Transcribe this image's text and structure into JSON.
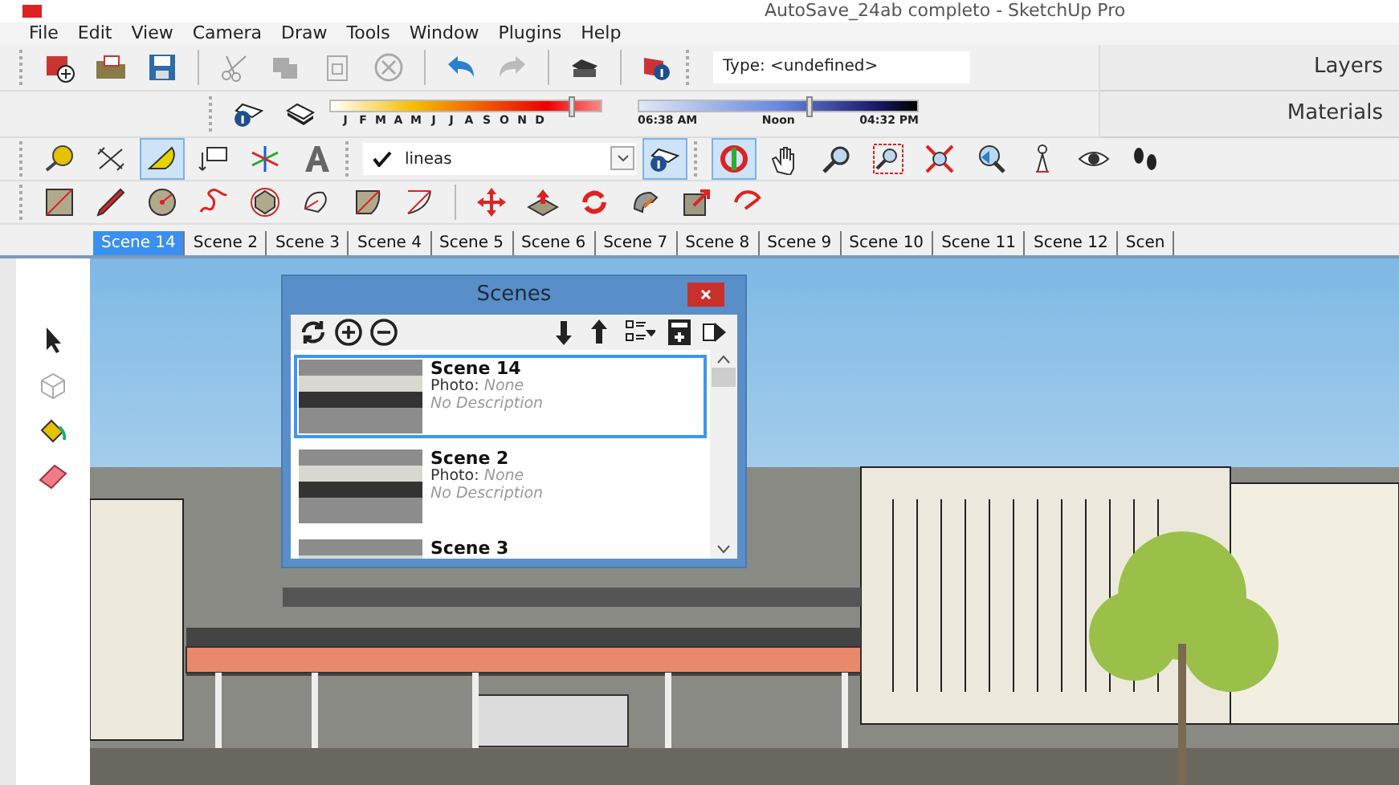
{
  "window": {
    "title": "AutoSave_24ab completo - SketchUp Pro"
  },
  "menu": [
    "File",
    "Edit",
    "View",
    "Camera",
    "Draw",
    "Tools",
    "Window",
    "Plugins",
    "Help"
  ],
  "measurements": {
    "text": "Type: <undefined>"
  },
  "tray_panels": [
    {
      "label": "Layers"
    },
    {
      "label": "Materials"
    }
  ],
  "shadows": {
    "months": [
      "J",
      "F",
      "M",
      "A",
      "M",
      "J",
      "J",
      "A",
      "S",
      "O",
      "N",
      "D"
    ],
    "date_slider": {
      "level": 0.88
    },
    "times": [
      "06:38 AM",
      "Noon",
      "04:32 PM"
    ],
    "time_slider": {
      "level": 0.6
    }
  },
  "construction_tools": [
    {
      "selected": false
    },
    {
      "selected": false
    },
    {
      "selected": true
    },
    {
      "selected": false
    },
    {
      "selected": false
    },
    {
      "selected": false
    }
  ],
  "layer_dropdown": {
    "value": "lineas",
    "checked": true
  },
  "layer_info_button": {
    "selected": true
  },
  "camera_tools": [
    {
      "selected": true
    },
    {
      "selected": false
    },
    {
      "selected": false
    },
    {
      "selected": false
    },
    {
      "selected": false
    },
    {
      "selected": false
    },
    {
      "selected": false
    },
    {
      "selected": false
    },
    {
      "selected": false
    }
  ],
  "scene_tabs": [
    {
      "label": "Scene 14",
      "selected": true
    },
    {
      "label": "Scene 2",
      "selected": false
    },
    {
      "label": "Scene 3",
      "selected": false
    },
    {
      "label": "Scene 4",
      "selected": false
    },
    {
      "label": "Scene 5",
      "selected": false
    },
    {
      "label": "Scene 6",
      "selected": false
    },
    {
      "label": "Scene 7",
      "selected": false
    },
    {
      "label": "Scene 8",
      "selected": false
    },
    {
      "label": "Scene 9",
      "selected": false
    },
    {
      "label": "Scene 10",
      "selected": false
    },
    {
      "label": "Scene 11",
      "selected": false
    },
    {
      "label": "Scene 12",
      "selected": false
    },
    {
      "label": "Scen",
      "selected": false
    }
  ],
  "scenes_dialog": {
    "title": "Scenes",
    "items": [
      {
        "name": "Scene 14",
        "photo_label": "Photo:",
        "photo": "None",
        "description": "No Description",
        "selected": true
      },
      {
        "name": "Scene 2",
        "photo_label": "Photo:",
        "photo": "None",
        "description": "No Description",
        "selected": false
      },
      {
        "name": "Scene 3",
        "selected": false
      }
    ]
  }
}
